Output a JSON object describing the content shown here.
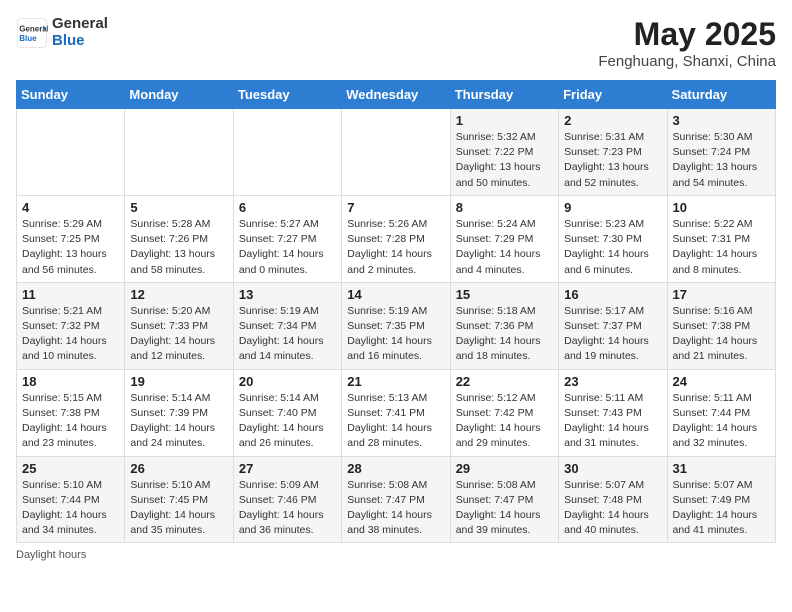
{
  "header": {
    "logo_general": "General",
    "logo_blue": "Blue",
    "month_title": "May 2025",
    "subtitle": "Fenghuang, Shanxi, China"
  },
  "days_of_week": [
    "Sunday",
    "Monday",
    "Tuesday",
    "Wednesday",
    "Thursday",
    "Friday",
    "Saturday"
  ],
  "footer": {
    "note": "Daylight hours"
  },
  "weeks": [
    [
      {
        "num": "",
        "info": ""
      },
      {
        "num": "",
        "info": ""
      },
      {
        "num": "",
        "info": ""
      },
      {
        "num": "",
        "info": ""
      },
      {
        "num": "1",
        "info": "Sunrise: 5:32 AM\nSunset: 7:22 PM\nDaylight: 13 hours\nand 50 minutes."
      },
      {
        "num": "2",
        "info": "Sunrise: 5:31 AM\nSunset: 7:23 PM\nDaylight: 13 hours\nand 52 minutes."
      },
      {
        "num": "3",
        "info": "Sunrise: 5:30 AM\nSunset: 7:24 PM\nDaylight: 13 hours\nand 54 minutes."
      }
    ],
    [
      {
        "num": "4",
        "info": "Sunrise: 5:29 AM\nSunset: 7:25 PM\nDaylight: 13 hours\nand 56 minutes."
      },
      {
        "num": "5",
        "info": "Sunrise: 5:28 AM\nSunset: 7:26 PM\nDaylight: 13 hours\nand 58 minutes."
      },
      {
        "num": "6",
        "info": "Sunrise: 5:27 AM\nSunset: 7:27 PM\nDaylight: 14 hours\nand 0 minutes."
      },
      {
        "num": "7",
        "info": "Sunrise: 5:26 AM\nSunset: 7:28 PM\nDaylight: 14 hours\nand 2 minutes."
      },
      {
        "num": "8",
        "info": "Sunrise: 5:24 AM\nSunset: 7:29 PM\nDaylight: 14 hours\nand 4 minutes."
      },
      {
        "num": "9",
        "info": "Sunrise: 5:23 AM\nSunset: 7:30 PM\nDaylight: 14 hours\nand 6 minutes."
      },
      {
        "num": "10",
        "info": "Sunrise: 5:22 AM\nSunset: 7:31 PM\nDaylight: 14 hours\nand 8 minutes."
      }
    ],
    [
      {
        "num": "11",
        "info": "Sunrise: 5:21 AM\nSunset: 7:32 PM\nDaylight: 14 hours\nand 10 minutes."
      },
      {
        "num": "12",
        "info": "Sunrise: 5:20 AM\nSunset: 7:33 PM\nDaylight: 14 hours\nand 12 minutes."
      },
      {
        "num": "13",
        "info": "Sunrise: 5:19 AM\nSunset: 7:34 PM\nDaylight: 14 hours\nand 14 minutes."
      },
      {
        "num": "14",
        "info": "Sunrise: 5:19 AM\nSunset: 7:35 PM\nDaylight: 14 hours\nand 16 minutes."
      },
      {
        "num": "15",
        "info": "Sunrise: 5:18 AM\nSunset: 7:36 PM\nDaylight: 14 hours\nand 18 minutes."
      },
      {
        "num": "16",
        "info": "Sunrise: 5:17 AM\nSunset: 7:37 PM\nDaylight: 14 hours\nand 19 minutes."
      },
      {
        "num": "17",
        "info": "Sunrise: 5:16 AM\nSunset: 7:38 PM\nDaylight: 14 hours\nand 21 minutes."
      }
    ],
    [
      {
        "num": "18",
        "info": "Sunrise: 5:15 AM\nSunset: 7:38 PM\nDaylight: 14 hours\nand 23 minutes."
      },
      {
        "num": "19",
        "info": "Sunrise: 5:14 AM\nSunset: 7:39 PM\nDaylight: 14 hours\nand 24 minutes."
      },
      {
        "num": "20",
        "info": "Sunrise: 5:14 AM\nSunset: 7:40 PM\nDaylight: 14 hours\nand 26 minutes."
      },
      {
        "num": "21",
        "info": "Sunrise: 5:13 AM\nSunset: 7:41 PM\nDaylight: 14 hours\nand 28 minutes."
      },
      {
        "num": "22",
        "info": "Sunrise: 5:12 AM\nSunset: 7:42 PM\nDaylight: 14 hours\nand 29 minutes."
      },
      {
        "num": "23",
        "info": "Sunrise: 5:11 AM\nSunset: 7:43 PM\nDaylight: 14 hours\nand 31 minutes."
      },
      {
        "num": "24",
        "info": "Sunrise: 5:11 AM\nSunset: 7:44 PM\nDaylight: 14 hours\nand 32 minutes."
      }
    ],
    [
      {
        "num": "25",
        "info": "Sunrise: 5:10 AM\nSunset: 7:44 PM\nDaylight: 14 hours\nand 34 minutes."
      },
      {
        "num": "26",
        "info": "Sunrise: 5:10 AM\nSunset: 7:45 PM\nDaylight: 14 hours\nand 35 minutes."
      },
      {
        "num": "27",
        "info": "Sunrise: 5:09 AM\nSunset: 7:46 PM\nDaylight: 14 hours\nand 36 minutes."
      },
      {
        "num": "28",
        "info": "Sunrise: 5:08 AM\nSunset: 7:47 PM\nDaylight: 14 hours\nand 38 minutes."
      },
      {
        "num": "29",
        "info": "Sunrise: 5:08 AM\nSunset: 7:47 PM\nDaylight: 14 hours\nand 39 minutes."
      },
      {
        "num": "30",
        "info": "Sunrise: 5:07 AM\nSunset: 7:48 PM\nDaylight: 14 hours\nand 40 minutes."
      },
      {
        "num": "31",
        "info": "Sunrise: 5:07 AM\nSunset: 7:49 PM\nDaylight: 14 hours\nand 41 minutes."
      }
    ]
  ]
}
